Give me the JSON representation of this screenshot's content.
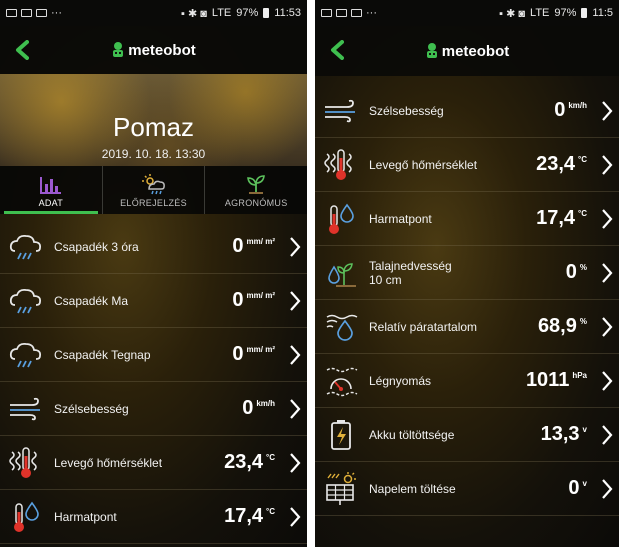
{
  "status_bar": {
    "left_icons": [
      "mail-icon",
      "image-icon",
      "image-icon",
      "more-dots"
    ],
    "battery_percent": "97%",
    "network": "LTE",
    "time_left": "11:53",
    "time_right": "11:5"
  },
  "app": {
    "brand": "meteobot"
  },
  "hero": {
    "city": "Pomaz",
    "datetime": "2019. 10. 18. 13:30"
  },
  "tabs": [
    {
      "label": "ADAT",
      "active": true,
      "icon": "bar-chart-icon"
    },
    {
      "label": "ELŐREJELZÉS",
      "active": false,
      "icon": "forecast-icon"
    },
    {
      "label": "AGRONÓMUS",
      "active": false,
      "icon": "sprout-icon"
    }
  ],
  "left_rows": [
    {
      "label": "Csapadék 3 óra",
      "value": "0",
      "unit": "mm/ m²",
      "icon": "rain-cloud-icon"
    },
    {
      "label": "Csapadék Ma",
      "value": "0",
      "unit": "mm/ m²",
      "icon": "rain-cloud-icon"
    },
    {
      "label": "Csapadék Tegnap",
      "value": "0",
      "unit": "mm/ m²",
      "icon": "rain-cloud-icon"
    },
    {
      "label": "Szélsebesség",
      "value": "0",
      "unit": "km/h",
      "icon": "wind-icon"
    },
    {
      "label": "Levegő hőmérséklet",
      "value": "23,4",
      "unit": "°C",
      "icon": "thermometer-heat-icon"
    },
    {
      "label": "Harmatpont",
      "value": "17,4",
      "unit": "°C",
      "icon": "dewpoint-icon"
    }
  ],
  "right_rows": [
    {
      "label": "Szélsebesség",
      "value": "0",
      "unit": "km/h",
      "icon": "wind-icon"
    },
    {
      "label": "Levegő hőmérséklet",
      "value": "23,4",
      "unit": "°C",
      "icon": "thermometer-heat-icon"
    },
    {
      "label": "Harmatpont",
      "value": "17,4",
      "unit": "°C",
      "icon": "dewpoint-icon"
    },
    {
      "label": "Talajnedvesség\n10 cm",
      "value": "0",
      "unit": "%",
      "icon": "soil-moisture-icon"
    },
    {
      "label": "Relatív páratartalom",
      "value": "68,9",
      "unit": "%",
      "icon": "humidity-icon"
    },
    {
      "label": "Légnyomás",
      "value": "1011",
      "unit": "hPa",
      "icon": "pressure-icon"
    },
    {
      "label": "Akku töltöttsége",
      "value": "13,3",
      "unit": "v",
      "icon": "battery-icon"
    },
    {
      "label": "Napelem töltése",
      "value": "0",
      "unit": "v",
      "icon": "solar-panel-icon"
    }
  ],
  "colors": {
    "accent": "#3fbf4f",
    "background": "#14110a",
    "text": "#ffffff"
  }
}
